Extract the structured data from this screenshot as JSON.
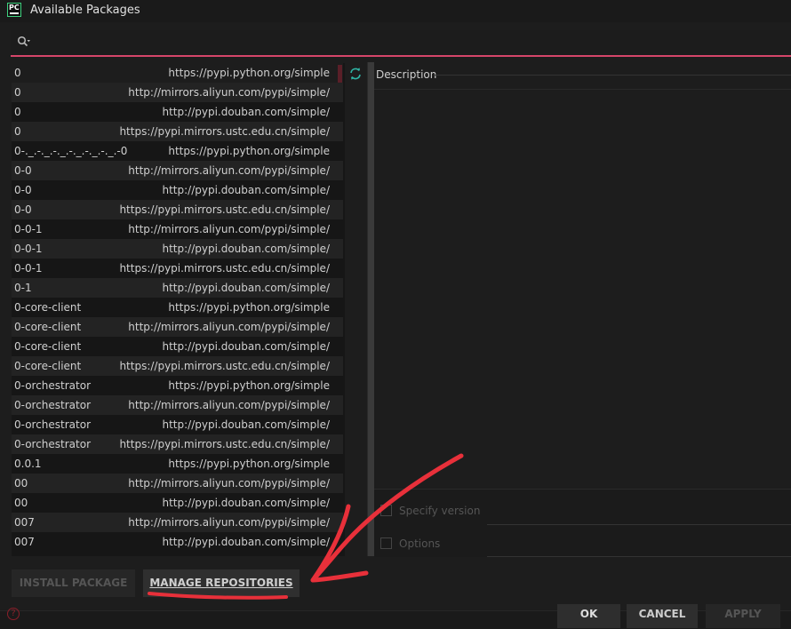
{
  "window": {
    "title": "Available Packages",
    "logo_text": "PC"
  },
  "search": {
    "value": "",
    "placeholder": ""
  },
  "packages": [
    {
      "name": "0",
      "repo": "https://pypi.python.org/simple"
    },
    {
      "name": "0",
      "repo": "http://mirrors.aliyun.com/pypi/simple/"
    },
    {
      "name": "0",
      "repo": "http://pypi.douban.com/simple/"
    },
    {
      "name": "0",
      "repo": "https://pypi.mirrors.ustc.edu.cn/simple/"
    },
    {
      "name": "0-._.-._.-._.-._.-._.-._.-0",
      "repo": "https://pypi.python.org/simple"
    },
    {
      "name": "0-0",
      "repo": "http://mirrors.aliyun.com/pypi/simple/"
    },
    {
      "name": "0-0",
      "repo": "http://pypi.douban.com/simple/"
    },
    {
      "name": "0-0",
      "repo": "https://pypi.mirrors.ustc.edu.cn/simple/"
    },
    {
      "name": "0-0-1",
      "repo": "http://mirrors.aliyun.com/pypi/simple/"
    },
    {
      "name": "0-0-1",
      "repo": "http://pypi.douban.com/simple/"
    },
    {
      "name": "0-0-1",
      "repo": "https://pypi.mirrors.ustc.edu.cn/simple/"
    },
    {
      "name": "0-1",
      "repo": "http://pypi.douban.com/simple/"
    },
    {
      "name": "0-core-client",
      "repo": "https://pypi.python.org/simple"
    },
    {
      "name": "0-core-client",
      "repo": "http://mirrors.aliyun.com/pypi/simple/"
    },
    {
      "name": "0-core-client",
      "repo": "http://pypi.douban.com/simple/"
    },
    {
      "name": "0-core-client",
      "repo": "https://pypi.mirrors.ustc.edu.cn/simple/"
    },
    {
      "name": "0-orchestrator",
      "repo": "https://pypi.python.org/simple"
    },
    {
      "name": "0-orchestrator",
      "repo": "http://mirrors.aliyun.com/pypi/simple/"
    },
    {
      "name": "0-orchestrator",
      "repo": "http://pypi.douban.com/simple/"
    },
    {
      "name": "0-orchestrator",
      "repo": "https://pypi.mirrors.ustc.edu.cn/simple/"
    },
    {
      "name": "0.0.1",
      "repo": "https://pypi.python.org/simple"
    },
    {
      "name": "00",
      "repo": "http://mirrors.aliyun.com/pypi/simple/"
    },
    {
      "name": "00",
      "repo": "http://pypi.douban.com/simple/"
    },
    {
      "name": "007",
      "repo": "http://mirrors.aliyun.com/pypi/simple/"
    },
    {
      "name": "007",
      "repo": "http://pypi.douban.com/simple/"
    }
  ],
  "description": {
    "label": "Description"
  },
  "options": {
    "specify_version_label": "Specify version",
    "options_label": "Options",
    "specify_version_checked": false,
    "options_checked": false
  },
  "buttons": {
    "install": "INSTALL PACKAGE",
    "manage": "MANAGE REPOSITORIES",
    "ok": "OK",
    "cancel": "CANCEL",
    "apply": "APPLY"
  },
  "icons": {
    "search": "search-icon",
    "refresh": "refresh-icon",
    "help": "help-icon"
  },
  "colors": {
    "accent": "#d64569",
    "refresh": "#2fb5a5",
    "annotation": "#e8303a"
  }
}
